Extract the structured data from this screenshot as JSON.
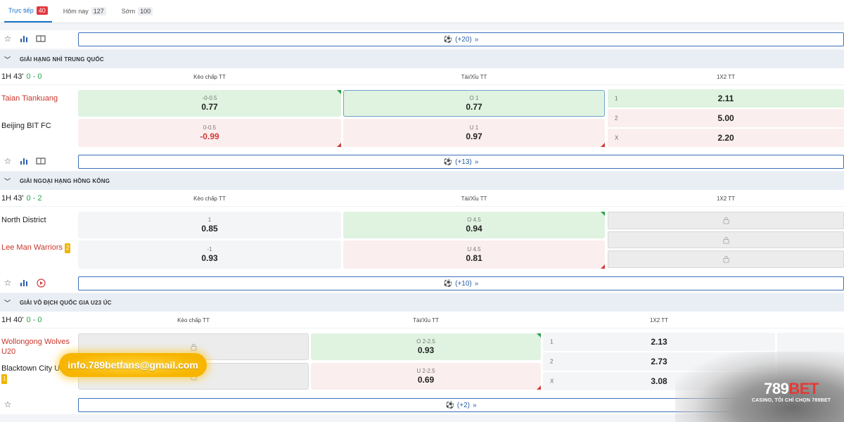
{
  "tabs": [
    {
      "label": "Trực tiếp",
      "count": "40"
    },
    {
      "label": "Hôm nay",
      "count": "127"
    },
    {
      "label": "Sớm",
      "count": "100"
    }
  ],
  "more_top": "(+20)",
  "columns": {
    "handicap": "Kèo chấp TT",
    "overunder": "Tài/Xỉu TT",
    "x12": "1X2 TT"
  },
  "leagues": [
    {
      "name": "GIẢI HẠNG NHÌ TRUNG QUỐC",
      "time": "1H 43'",
      "score": "0 - 0",
      "home": "Taian Tiankuang",
      "away": "Beijing BIT FC",
      "hdp": [
        {
          "line": "-0-0.5",
          "odd": "0.77"
        },
        {
          "line": "0-0.5",
          "odd": "-0.99"
        }
      ],
      "ou": [
        {
          "line": "O 1",
          "odd": "0.77"
        },
        {
          "line": "U 1",
          "odd": "0.97"
        }
      ],
      "x12": [
        {
          "label": "1",
          "odd": "2.11"
        },
        {
          "label": "2",
          "odd": "5.00"
        },
        {
          "label": "X",
          "odd": "2.20"
        }
      ],
      "more": "(+13)"
    },
    {
      "name": "GIẢI NGOẠI HẠNG HỒNG KÔNG",
      "time": "1H 43'",
      "score": "0 - 2",
      "home": "North District",
      "away": "Lee Man Warriors",
      "away_badge": "2",
      "hdp": [
        {
          "line": "1",
          "odd": "0.85"
        },
        {
          "line": "-1",
          "odd": "0.93"
        }
      ],
      "ou": [
        {
          "line": "O 4.5",
          "odd": "0.94"
        },
        {
          "line": "U 4.5",
          "odd": "0.81"
        }
      ],
      "more": "(+10)"
    },
    {
      "name": "GIẢI VÔ ĐỊCH QUỐC GIA U23 ÚC",
      "time": "1H 40'",
      "score": "0 - 0",
      "home": "Wollongong Wolves U20",
      "away": "Blacktown City U2",
      "away_badge": "1",
      "ou": [
        {
          "line": "O 2-2.5",
          "odd": "0.93"
        },
        {
          "line": "U 2-2.5",
          "odd": "0.69"
        }
      ],
      "x12": [
        {
          "label": "1",
          "odd": "2.13"
        },
        {
          "label": "2",
          "odd": "2.73"
        },
        {
          "label": "X",
          "odd": "3.08"
        }
      ],
      "more": "(+2)"
    }
  ],
  "overlay": {
    "email": "info.789betfans@gmail.com"
  },
  "logo": {
    "brand_a": "789",
    "brand_b": "BET",
    "tagline": "CASINO, TÔI CHỈ CHỌN 789BET"
  },
  "colors": {
    "accent": "#1a73c8",
    "live_badge": "#e2373f",
    "win_green": "#2ba24c",
    "drop_red": "#d23c3c",
    "link_blue": "#2b5ea7"
  }
}
